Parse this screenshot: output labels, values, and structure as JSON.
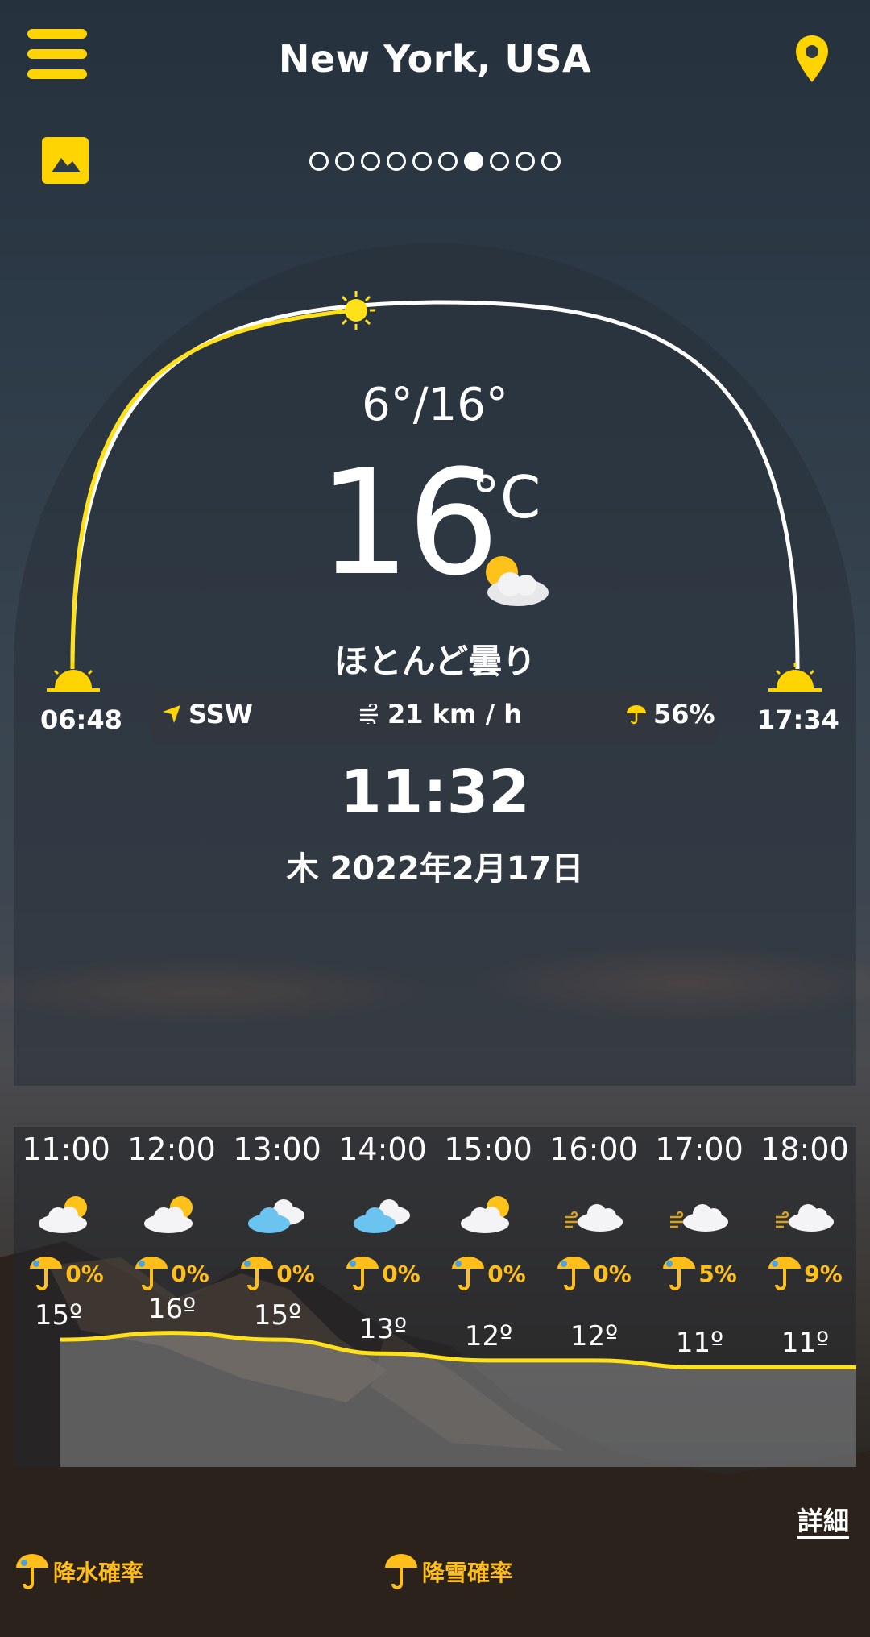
{
  "header": {
    "city": "New York, USA",
    "menu_icon": "menu-icon",
    "location_icon": "location-pin-icon",
    "gallery_icon": "image-icon",
    "page_count": 10,
    "active_page": 7
  },
  "current": {
    "temp_range": "6°/16°",
    "temp": "16",
    "unit": "°C",
    "condition": "ほとんど曇り",
    "condition_icon": "partly-cloudy-icon",
    "sunrise": "06:48",
    "sunset": "17:34",
    "wind_direction": "SSW",
    "wind_speed": "21 km / h",
    "precipitation": "56%",
    "time": "11:32",
    "date": "木 2022年2月17日"
  },
  "hourly": [
    {
      "time": "11:00",
      "icon": "partly-cloudy-icon",
      "rain": "0%",
      "temp": "15º",
      "t": 15
    },
    {
      "time": "12:00",
      "icon": "partly-cloudy-icon",
      "rain": "0%",
      "temp": "16º",
      "t": 16
    },
    {
      "time": "13:00",
      "icon": "cloudy-icon",
      "rain": "0%",
      "temp": "15º",
      "t": 15
    },
    {
      "time": "14:00",
      "icon": "cloudy-icon",
      "rain": "0%",
      "temp": "13º",
      "t": 13
    },
    {
      "time": "15:00",
      "icon": "partly-cloudy-icon",
      "rain": "0%",
      "temp": "12º",
      "t": 12
    },
    {
      "time": "16:00",
      "icon": "windy-cloud-icon",
      "rain": "0%",
      "temp": "12º",
      "t": 12
    },
    {
      "time": "17:00",
      "icon": "windy-cloud-icon",
      "rain": "5%",
      "temp": "11º",
      "t": 11
    },
    {
      "time": "18:00",
      "icon": "windy-cloud-icon",
      "rain": "9%",
      "temp": "11º",
      "t": 11
    }
  ],
  "footer": {
    "detail_label": "詳細",
    "legend_rain": "降水確率",
    "legend_snow": "降雪確率"
  },
  "colors": {
    "accent": "#ffd400",
    "rain_text": "#ffbe1a",
    "arc_day": "#ffe11a"
  }
}
